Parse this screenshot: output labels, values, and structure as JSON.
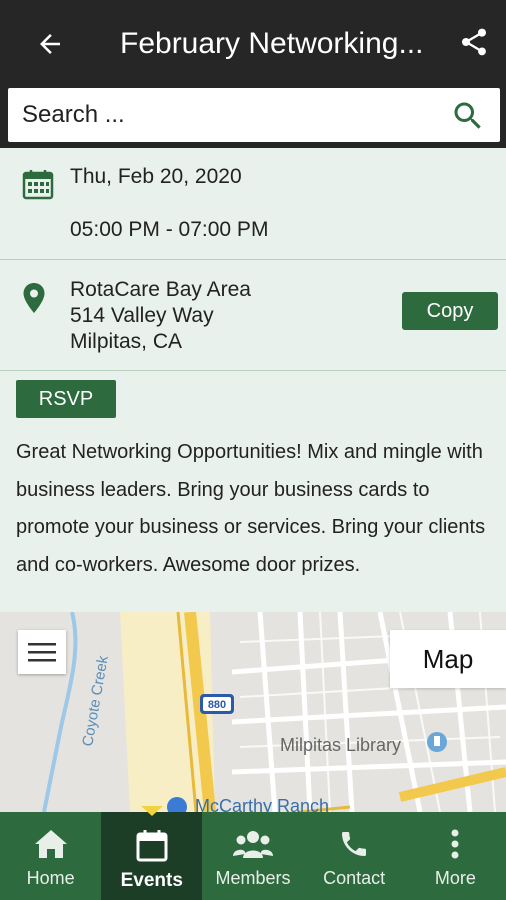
{
  "header": {
    "title": "February Networking...",
    "back_icon": "arrow-back-icon",
    "share_icon": "share-icon"
  },
  "search": {
    "placeholder": "Search ..."
  },
  "event": {
    "date": "Thu, Feb 20, 2020",
    "time": "05:00 PM - 07:00 PM",
    "location_name": "RotaCare Bay Area",
    "address_line1": "514 Valley Way",
    "address_line2": "Milpitas, CA",
    "copy_label": "Copy",
    "rsvp_label": "RSVP",
    "description": "Great Networking Opportunities! Mix and mingle with business leaders. Bring your business cards to promote your business or services. Bring your clients and co-workers. Awesome door prizes."
  },
  "map": {
    "tab_label": "Map",
    "labels": {
      "creek": "Coyote Creek",
      "highway": "880",
      "library": "Milpitas Library",
      "ranch": "McCarthy Ranch"
    }
  },
  "nav": {
    "items": [
      {
        "label": "Home",
        "icon": "home-icon"
      },
      {
        "label": "Events",
        "icon": "calendar-icon"
      },
      {
        "label": "Members",
        "icon": "members-icon"
      },
      {
        "label": "Contact",
        "icon": "phone-icon"
      },
      {
        "label": "More",
        "icon": "more-vert-icon"
      }
    ],
    "active": "Events"
  },
  "colors": {
    "accent": "#2d6a3e",
    "appbar": "#262626",
    "nav_active": "#1c3d26",
    "marker": "#f1d341",
    "background": "#e9f1ec"
  }
}
